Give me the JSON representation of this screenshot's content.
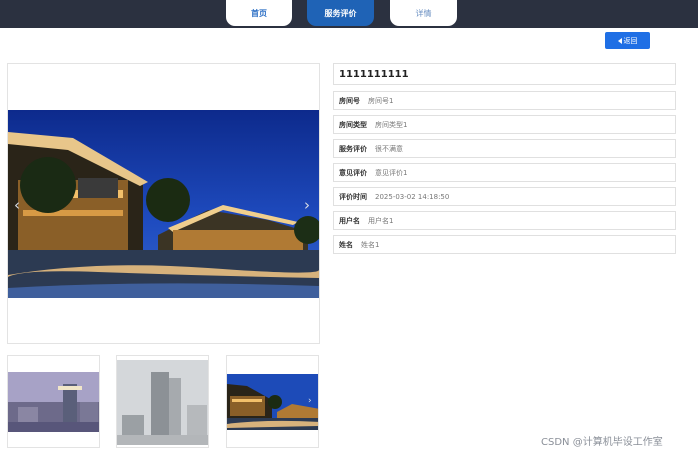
{
  "nav": {
    "tabs": [
      {
        "label": "首页"
      },
      {
        "label": "服务评价"
      },
      {
        "label": "详情"
      }
    ]
  },
  "back_button": {
    "label": "返回"
  },
  "detail": {
    "title": "1111111111",
    "fields": [
      {
        "key": "房间号",
        "value": "房间号1"
      },
      {
        "key": "房间类型",
        "value": "房间类型1"
      },
      {
        "key": "服务评价",
        "value": "很不满意"
      },
      {
        "key": "意见评价",
        "value": "意见评价1"
      },
      {
        "key": "评价时间",
        "value": "2025-03-02 14:18:50"
      },
      {
        "key": "用户名",
        "value": "用户名1"
      },
      {
        "key": "姓名",
        "value": "姓名1"
      }
    ]
  },
  "carousel": {
    "prev_icon": "chevron-left-icon",
    "next_icon": "chevron-right-icon",
    "thumbnails": 3
  },
  "watermark": "CSDN @计算机毕设工作室",
  "colors": {
    "topbar": "#2b3140",
    "active_tab": "#1f63b6",
    "back_button": "#1f6fe5"
  }
}
